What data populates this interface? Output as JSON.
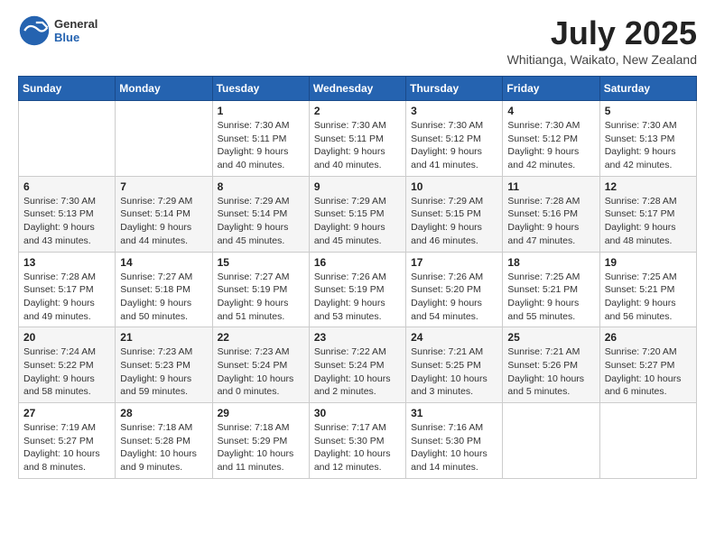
{
  "header": {
    "logo_general": "General",
    "logo_blue": "Blue",
    "title": "July 2025",
    "location": "Whitianga, Waikato, New Zealand"
  },
  "weekdays": [
    "Sunday",
    "Monday",
    "Tuesday",
    "Wednesday",
    "Thursday",
    "Friday",
    "Saturday"
  ],
  "weeks": [
    [
      {
        "day": "",
        "info": ""
      },
      {
        "day": "",
        "info": ""
      },
      {
        "day": "1",
        "info": "Sunrise: 7:30 AM\nSunset: 5:11 PM\nDaylight: 9 hours and 40 minutes."
      },
      {
        "day": "2",
        "info": "Sunrise: 7:30 AM\nSunset: 5:11 PM\nDaylight: 9 hours and 40 minutes."
      },
      {
        "day": "3",
        "info": "Sunrise: 7:30 AM\nSunset: 5:12 PM\nDaylight: 9 hours and 41 minutes."
      },
      {
        "day": "4",
        "info": "Sunrise: 7:30 AM\nSunset: 5:12 PM\nDaylight: 9 hours and 42 minutes."
      },
      {
        "day": "5",
        "info": "Sunrise: 7:30 AM\nSunset: 5:13 PM\nDaylight: 9 hours and 42 minutes."
      }
    ],
    [
      {
        "day": "6",
        "info": "Sunrise: 7:30 AM\nSunset: 5:13 PM\nDaylight: 9 hours and 43 minutes."
      },
      {
        "day": "7",
        "info": "Sunrise: 7:29 AM\nSunset: 5:14 PM\nDaylight: 9 hours and 44 minutes."
      },
      {
        "day": "8",
        "info": "Sunrise: 7:29 AM\nSunset: 5:14 PM\nDaylight: 9 hours and 45 minutes."
      },
      {
        "day": "9",
        "info": "Sunrise: 7:29 AM\nSunset: 5:15 PM\nDaylight: 9 hours and 45 minutes."
      },
      {
        "day": "10",
        "info": "Sunrise: 7:29 AM\nSunset: 5:15 PM\nDaylight: 9 hours and 46 minutes."
      },
      {
        "day": "11",
        "info": "Sunrise: 7:28 AM\nSunset: 5:16 PM\nDaylight: 9 hours and 47 minutes."
      },
      {
        "day": "12",
        "info": "Sunrise: 7:28 AM\nSunset: 5:17 PM\nDaylight: 9 hours and 48 minutes."
      }
    ],
    [
      {
        "day": "13",
        "info": "Sunrise: 7:28 AM\nSunset: 5:17 PM\nDaylight: 9 hours and 49 minutes."
      },
      {
        "day": "14",
        "info": "Sunrise: 7:27 AM\nSunset: 5:18 PM\nDaylight: 9 hours and 50 minutes."
      },
      {
        "day": "15",
        "info": "Sunrise: 7:27 AM\nSunset: 5:19 PM\nDaylight: 9 hours and 51 minutes."
      },
      {
        "day": "16",
        "info": "Sunrise: 7:26 AM\nSunset: 5:19 PM\nDaylight: 9 hours and 53 minutes."
      },
      {
        "day": "17",
        "info": "Sunrise: 7:26 AM\nSunset: 5:20 PM\nDaylight: 9 hours and 54 minutes."
      },
      {
        "day": "18",
        "info": "Sunrise: 7:25 AM\nSunset: 5:21 PM\nDaylight: 9 hours and 55 minutes."
      },
      {
        "day": "19",
        "info": "Sunrise: 7:25 AM\nSunset: 5:21 PM\nDaylight: 9 hours and 56 minutes."
      }
    ],
    [
      {
        "day": "20",
        "info": "Sunrise: 7:24 AM\nSunset: 5:22 PM\nDaylight: 9 hours and 58 minutes."
      },
      {
        "day": "21",
        "info": "Sunrise: 7:23 AM\nSunset: 5:23 PM\nDaylight: 9 hours and 59 minutes."
      },
      {
        "day": "22",
        "info": "Sunrise: 7:23 AM\nSunset: 5:24 PM\nDaylight: 10 hours and 0 minutes."
      },
      {
        "day": "23",
        "info": "Sunrise: 7:22 AM\nSunset: 5:24 PM\nDaylight: 10 hours and 2 minutes."
      },
      {
        "day": "24",
        "info": "Sunrise: 7:21 AM\nSunset: 5:25 PM\nDaylight: 10 hours and 3 minutes."
      },
      {
        "day": "25",
        "info": "Sunrise: 7:21 AM\nSunset: 5:26 PM\nDaylight: 10 hours and 5 minutes."
      },
      {
        "day": "26",
        "info": "Sunrise: 7:20 AM\nSunset: 5:27 PM\nDaylight: 10 hours and 6 minutes."
      }
    ],
    [
      {
        "day": "27",
        "info": "Sunrise: 7:19 AM\nSunset: 5:27 PM\nDaylight: 10 hours and 8 minutes."
      },
      {
        "day": "28",
        "info": "Sunrise: 7:18 AM\nSunset: 5:28 PM\nDaylight: 10 hours and 9 minutes."
      },
      {
        "day": "29",
        "info": "Sunrise: 7:18 AM\nSunset: 5:29 PM\nDaylight: 10 hours and 11 minutes."
      },
      {
        "day": "30",
        "info": "Sunrise: 7:17 AM\nSunset: 5:30 PM\nDaylight: 10 hours and 12 minutes."
      },
      {
        "day": "31",
        "info": "Sunrise: 7:16 AM\nSunset: 5:30 PM\nDaylight: 10 hours and 14 minutes."
      },
      {
        "day": "",
        "info": ""
      },
      {
        "day": "",
        "info": ""
      }
    ]
  ]
}
